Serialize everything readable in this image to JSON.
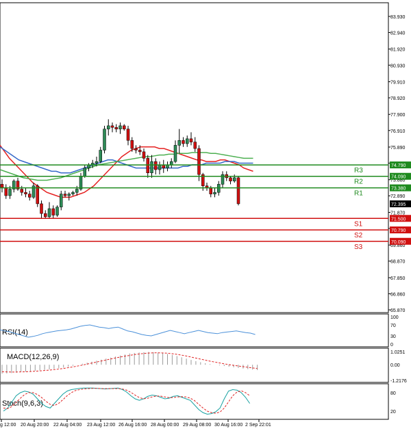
{
  "colors": {
    "bull_candle": "#2e8b57",
    "bear_candle": "#d01010",
    "ma_red": "#e52121",
    "ma_blue": "#3568c8",
    "ma_green": "#4caf50",
    "level_green": "#1e8a1e",
    "level_red": "#d01010",
    "rsi_line": "#4a90d9",
    "macd_signal": "#e02020",
    "stoch_main": "#16a0a0",
    "stoch_signal": "#e02020"
  },
  "price_axis": {
    "ticks": [
      "83.930",
      "82.940",
      "81.920",
      "80.930",
      "79.910",
      "78.920",
      "77.900",
      "76.910",
      "75.890",
      "74.900",
      "73.880",
      "72.890",
      "71.870",
      "70.880",
      "69.860",
      "68.870",
      "67.850",
      "66.860",
      "65.870"
    ],
    "tick_values": [
      83.93,
      82.94,
      81.92,
      80.93,
      79.91,
      78.92,
      77.9,
      76.91,
      75.89,
      74.9,
      73.88,
      72.89,
      71.87,
      70.88,
      69.86,
      68.87,
      67.85,
      66.86,
      65.87
    ],
    "range": [
      65.87,
      84.43
    ],
    "current_price": "72.395",
    "current_value": 72.395
  },
  "levels": [
    {
      "name": "R3",
      "price": "74.790",
      "value": 74.79,
      "kind": "resistance"
    },
    {
      "name": "R2",
      "price": "74.090",
      "value": 74.09,
      "kind": "resistance"
    },
    {
      "name": "R1",
      "price": "73.380",
      "value": 73.38,
      "kind": "resistance"
    },
    {
      "name": "S1",
      "price": "71.500",
      "value": 71.5,
      "kind": "support"
    },
    {
      "name": "S2",
      "price": "70.790",
      "value": 70.79,
      "kind": "support"
    },
    {
      "name": "S3",
      "price": "70.090",
      "value": 70.09,
      "kind": "support"
    }
  ],
  "time_axis": {
    "labels": [
      "g 12:00",
      "20 Aug 20:00",
      "22 Aug 04:00",
      "23 Aug 12:00",
      "26 Aug 16:00",
      "28 Aug 00:00",
      "29 Aug 08:00",
      "30 Aug 16:00",
      "2 Sep 22:01"
    ],
    "bar_index": [
      0,
      11,
      19,
      26,
      33,
      41,
      49,
      58,
      65
    ]
  },
  "candles": [
    [
      73.6,
      73.9,
      73.1,
      73.4
    ],
    [
      73.4,
      73.6,
      72.7,
      72.9
    ],
    [
      72.9,
      73.5,
      72.7,
      73.3
    ],
    [
      73.3,
      73.9,
      73.1,
      73.8
    ],
    [
      73.8,
      74.0,
      73.2,
      73.3
    ],
    [
      73.3,
      73.5,
      72.9,
      73.1
    ],
    [
      73.1,
      73.4,
      72.8,
      73.0
    ],
    [
      73.0,
      73.2,
      72.6,
      72.8
    ],
    [
      72.8,
      73.7,
      72.7,
      73.5
    ],
    [
      73.5,
      73.6,
      72.2,
      72.4
    ],
    [
      72.4,
      72.6,
      71.5,
      71.8
    ],
    [
      71.8,
      72.0,
      71.5,
      71.6
    ],
    [
      71.6,
      72.5,
      71.5,
      72.1
    ],
    [
      72.1,
      72.3,
      71.5,
      71.7
    ],
    [
      71.7,
      72.3,
      71.6,
      72.2
    ],
    [
      72.2,
      73.2,
      72.0,
      73.0
    ],
    [
      73.0,
      73.2,
      72.8,
      72.9
    ],
    [
      72.9,
      73.1,
      72.6,
      73.0
    ],
    [
      73.0,
      73.2,
      72.9,
      73.1
    ],
    [
      73.1,
      73.5,
      72.9,
      73.3
    ],
    [
      73.3,
      74.3,
      73.2,
      74.1
    ],
    [
      74.1,
      74.8,
      74.0,
      74.6
    ],
    [
      74.6,
      74.9,
      74.4,
      74.8
    ],
    [
      74.8,
      75.1,
      74.6,
      74.9
    ],
    [
      74.9,
      75.3,
      74.7,
      75.0
    ],
    [
      75.0,
      75.9,
      74.9,
      75.7
    ],
    [
      75.7,
      77.2,
      75.5,
      77.0
    ],
    [
      77.0,
      77.6,
      76.6,
      77.2
    ],
    [
      77.2,
      77.4,
      76.8,
      77.1
    ],
    [
      77.1,
      77.3,
      76.8,
      77.0
    ],
    [
      77.0,
      77.4,
      76.7,
      77.2
    ],
    [
      77.2,
      77.3,
      76.9,
      77.0
    ],
    [
      77.0,
      77.2,
      76.0,
      76.3
    ],
    [
      76.3,
      76.5,
      75.6,
      75.8
    ],
    [
      75.8,
      76.0,
      75.5,
      75.7
    ],
    [
      75.7,
      76.0,
      75.4,
      75.6
    ],
    [
      75.6,
      75.8,
      75.0,
      75.2
    ],
    [
      75.2,
      75.4,
      74.0,
      74.3
    ],
    [
      74.3,
      75.4,
      74.0,
      75.0
    ],
    [
      75.0,
      75.2,
      74.2,
      74.5
    ],
    [
      74.5,
      75.0,
      74.2,
      74.8
    ],
    [
      74.8,
      75.1,
      74.3,
      74.6
    ],
    [
      74.6,
      75.0,
      74.4,
      74.8
    ],
    [
      74.8,
      75.2,
      74.6,
      75.0
    ],
    [
      75.0,
      76.3,
      74.9,
      76.0
    ],
    [
      76.0,
      77.0,
      75.5,
      76.3
    ],
    [
      76.3,
      76.5,
      75.9,
      76.1
    ],
    [
      76.1,
      76.6,
      75.9,
      76.4
    ],
    [
      76.4,
      76.8,
      76.0,
      76.2
    ],
    [
      76.2,
      76.5,
      75.6,
      75.8
    ],
    [
      75.8,
      76.0,
      73.8,
      74.2
    ],
    [
      74.2,
      74.3,
      73.2,
      73.5
    ],
    [
      73.5,
      73.7,
      73.2,
      73.4
    ],
    [
      73.4,
      73.5,
      72.8,
      73.0
    ],
    [
      73.0,
      73.4,
      72.8,
      73.1
    ],
    [
      73.1,
      73.8,
      72.9,
      73.6
    ],
    [
      73.6,
      74.4,
      73.4,
      74.2
    ],
    [
      74.2,
      74.4,
      73.8,
      74.0
    ],
    [
      74.0,
      74.1,
      73.6,
      73.8
    ],
    [
      73.8,
      74.2,
      73.7,
      74.0
    ],
    [
      74.0,
      74.1,
      72.3,
      72.4
    ]
  ],
  "ma_series": {
    "red": [
      76.0,
      75.6,
      75.2,
      74.9,
      74.6,
      74.3,
      74.0,
      73.7,
      73.5,
      73.3,
      73.1,
      73.0,
      72.9,
      72.8,
      72.8,
      72.8,
      72.9,
      73.0,
      73.1,
      73.3,
      73.5,
      73.8,
      74.1,
      74.4,
      74.7,
      75.0,
      75.3,
      75.5,
      75.7,
      75.8,
      75.9,
      75.9,
      75.9,
      75.9,
      75.8,
      75.8,
      75.7,
      75.6,
      75.5,
      75.4,
      75.3,
      75.2,
      75.1,
      75.1,
      75.0,
      75.0,
      75.0,
      75.1,
      75.1,
      75.0,
      74.9,
      74.8,
      74.6,
      74.5,
      74.4
    ],
    "blue": [
      75.9,
      75.7,
      75.5,
      75.3,
      75.1,
      75.0,
      74.9,
      74.8,
      74.7,
      74.6,
      74.5,
      74.4,
      74.4,
      74.3,
      74.3,
      74.3,
      74.4,
      74.5,
      74.6,
      74.7,
      74.8,
      74.9,
      75.0,
      75.1,
      75.1,
      75.0,
      74.9,
      74.8,
      74.7,
      74.6,
      74.6,
      74.6,
      74.6,
      74.6,
      74.6,
      74.6,
      74.6,
      74.6,
      74.6,
      74.7,
      74.7,
      74.8,
      74.8,
      74.8,
      74.9,
      74.9,
      74.9,
      74.9,
      75.0,
      75.0,
      75.0,
      74.9,
      74.9,
      74.9,
      74.9
    ],
    "green": [
      74.5,
      74.4,
      74.3,
      74.2,
      74.1,
      74.0,
      73.95,
      73.9,
      73.85,
      73.85,
      73.85,
      73.9,
      73.95,
      74.0,
      74.1,
      74.2,
      74.3,
      74.4,
      74.5,
      74.6,
      74.7,
      74.8,
      74.85,
      74.9,
      74.95,
      75.0,
      75.05,
      75.1,
      75.15,
      75.2,
      75.25,
      75.3,
      75.3,
      75.35,
      75.4,
      75.4,
      75.45,
      75.45,
      75.5,
      75.5,
      75.5,
      75.55,
      75.55,
      75.55,
      75.55,
      75.5,
      75.5,
      75.45,
      75.4,
      75.35,
      75.3,
      75.25,
      75.2,
      75.2,
      75.2
    ]
  },
  "rsi": {
    "label": "RSI(14)",
    "axis_labels": [
      "100",
      "70",
      "30",
      "0"
    ],
    "axis_values": [
      100,
      70,
      30,
      0
    ],
    "values": [
      52,
      48,
      45,
      40,
      35,
      30,
      25,
      28,
      32,
      38,
      42,
      45,
      48,
      50,
      52,
      55,
      60,
      65,
      68,
      70,
      66,
      62,
      60,
      57,
      60,
      62,
      55,
      48,
      45,
      40,
      35,
      32,
      30,
      35,
      40,
      45,
      50,
      46,
      42,
      38,
      42,
      46,
      50,
      46,
      42,
      40,
      38,
      42,
      44,
      46,
      48,
      45,
      42,
      40,
      35
    ]
  },
  "macd": {
    "label": "MACD(12,26,9)",
    "axis_labels": [
      "1.0251",
      "0.00",
      "-1.2176"
    ],
    "axis_values": [
      1.0251,
      0,
      -1.2176
    ],
    "hist": [
      -0.7,
      -0.68,
      -0.65,
      -0.62,
      -0.58,
      -0.55,
      -0.52,
      -0.48,
      -0.44,
      -0.4,
      -0.36,
      -0.32,
      -0.28,
      -0.22,
      -0.16,
      -0.08,
      0.0,
      0.08,
      0.16,
      0.24,
      0.32,
      0.4,
      0.48,
      0.56,
      0.64,
      0.72,
      0.8,
      0.88,
      0.92,
      0.96,
      0.98,
      1.0,
      0.98,
      0.95,
      0.9,
      0.84,
      0.76,
      0.68,
      0.58,
      0.48,
      0.38,
      0.28,
      0.2,
      0.12,
      0.05,
      0.0,
      -0.05,
      -0.1,
      -0.15,
      -0.2,
      -0.25,
      -0.3,
      -0.34,
      -0.38,
      -0.42
    ],
    "signal": [
      -0.55,
      -0.56,
      -0.57,
      -0.57,
      -0.56,
      -0.55,
      -0.53,
      -0.51,
      -0.48,
      -0.45,
      -0.42,
      -0.38,
      -0.34,
      -0.29,
      -0.23,
      -0.17,
      -0.1,
      -0.03,
      0.05,
      0.13,
      0.21,
      0.29,
      0.37,
      0.45,
      0.53,
      0.6,
      0.67,
      0.73,
      0.79,
      0.84,
      0.88,
      0.91,
      0.93,
      0.93,
      0.92,
      0.9,
      0.86,
      0.81,
      0.75,
      0.68,
      0.6,
      0.52,
      0.44,
      0.36,
      0.28,
      0.21,
      0.14,
      0.07,
      0.01,
      -0.05,
      -0.1,
      -0.15,
      -0.2,
      -0.25,
      -0.29
    ]
  },
  "stoch": {
    "label": "Stoch(9,6,3)",
    "axis_labels": [
      "80",
      "20"
    ],
    "axis_values": [
      80,
      20
    ],
    "main": [
      20,
      30,
      50,
      70,
      80,
      85,
      82,
      75,
      60,
      45,
      35,
      30,
      45,
      60,
      75,
      85,
      90,
      92,
      94,
      95,
      95,
      95,
      94,
      93,
      92,
      93,
      94,
      95,
      90,
      82,
      70,
      60,
      55,
      60,
      68,
      72,
      70,
      65,
      60,
      62,
      68,
      70,
      65,
      60,
      55,
      40,
      25,
      15,
      10,
      12,
      18,
      30,
      60,
      85,
      90,
      88,
      80,
      65,
      45
    ],
    "signal": [
      30,
      28,
      35,
      48,
      62,
      74,
      80,
      80,
      74,
      64,
      52,
      42,
      38,
      45,
      57,
      70,
      80,
      87,
      90,
      92,
      93,
      94,
      94,
      93,
      93,
      93,
      93,
      93,
      92,
      88,
      81,
      72,
      64,
      60,
      62,
      66,
      69,
      69,
      66,
      64,
      64,
      66,
      67,
      66,
      62,
      54,
      42,
      30,
      20,
      15,
      13,
      17,
      30,
      50,
      70,
      82,
      86,
      80,
      70
    ]
  }
}
